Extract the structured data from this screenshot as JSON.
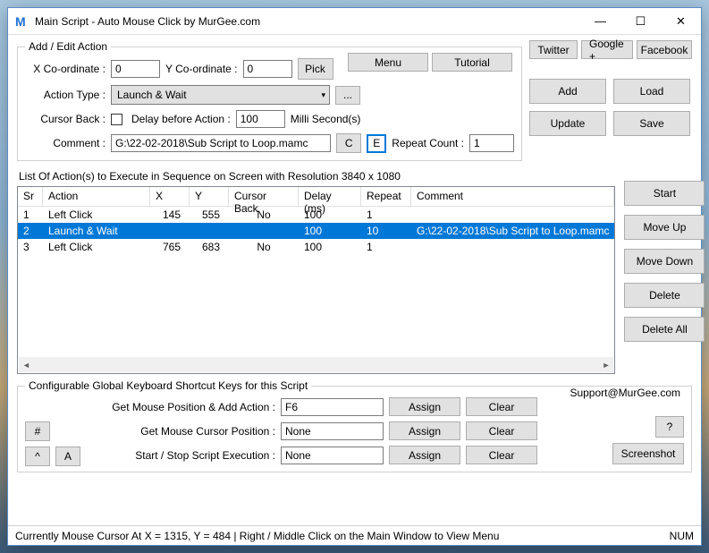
{
  "window": {
    "title": "Main Script - Auto Mouse Click by MurGee.com"
  },
  "topbtns": {
    "menu": "Menu",
    "tutorial": "Tutorial",
    "twitter": "Twitter",
    "google": "Google +",
    "facebook": "Facebook"
  },
  "addEdit": {
    "legend": "Add / Edit Action",
    "xLbl": "X Co-ordinate :",
    "x": "0",
    "yLbl": "Y Co-ordinate :",
    "y": "0",
    "pick": "Pick",
    "actionTypeLbl": "Action Type :",
    "actionType": "Launch & Wait",
    "ellipsis": "...",
    "cursorBackLbl": "Cursor Back :",
    "delayLbl": "Delay before Action :",
    "delay": "100",
    "delayUnit": "Milli Second(s)",
    "commentLbl": "Comment :",
    "comment": "G:\\22-02-2018\\Sub Script to Loop.mamc",
    "c": "C",
    "e": "E",
    "repeatLbl": "Repeat Count :",
    "repeat": "1"
  },
  "rightBtns": {
    "add": "Add",
    "load": "Load",
    "update": "Update",
    "save": "Save"
  },
  "list": {
    "caption": "List Of Action(s) to Execute in Sequence on Screen with Resolution 3840 x 1080",
    "headers": {
      "sr": "Sr",
      "action": "Action",
      "x": "X",
      "y": "Y",
      "cb": "Cursor Back",
      "delay": "Delay (ms)",
      "repeat": "Repeat",
      "comment": "Comment"
    },
    "rows": [
      {
        "sr": "1",
        "action": "Left Click",
        "x": "145",
        "y": "555",
        "cb": "No",
        "delay": "100",
        "repeat": "1",
        "comment": "",
        "sel": false
      },
      {
        "sr": "2",
        "action": "Launch & Wait",
        "x": "",
        "y": "",
        "cb": "",
        "delay": "100",
        "repeat": "10",
        "comment": "G:\\22-02-2018\\Sub Script to Loop.mamc",
        "sel": true
      },
      {
        "sr": "3",
        "action": "Left Click",
        "x": "765",
        "y": "683",
        "cb": "No",
        "delay": "100",
        "repeat": "1",
        "comment": "",
        "sel": false
      }
    ],
    "sideBtns": {
      "start": "Start",
      "moveUp": "Move Up",
      "moveDown": "Move Down",
      "delete": "Delete",
      "deleteAll": "Delete All"
    }
  },
  "shortcuts": {
    "legend": "Configurable Global Keyboard Shortcut Keys for this Script",
    "support": "Support@MurGee.com",
    "r1Lbl": "Get Mouse Position & Add Action :",
    "r1Val": "F6",
    "r2Lbl": "Get Mouse Cursor Position :",
    "r2Val": "None",
    "r3Lbl": "Start / Stop Script Execution :",
    "r3Val": "None",
    "assign": "Assign",
    "clear": "Clear",
    "hash": "#",
    "caret": "^",
    "a": "A",
    "q": "?",
    "screenshot": "Screenshot"
  },
  "status": {
    "msg": "Currently Mouse Cursor At X = 1315, Y = 484 | Right / Middle Click on the Main Window to View Menu",
    "num": "NUM"
  }
}
